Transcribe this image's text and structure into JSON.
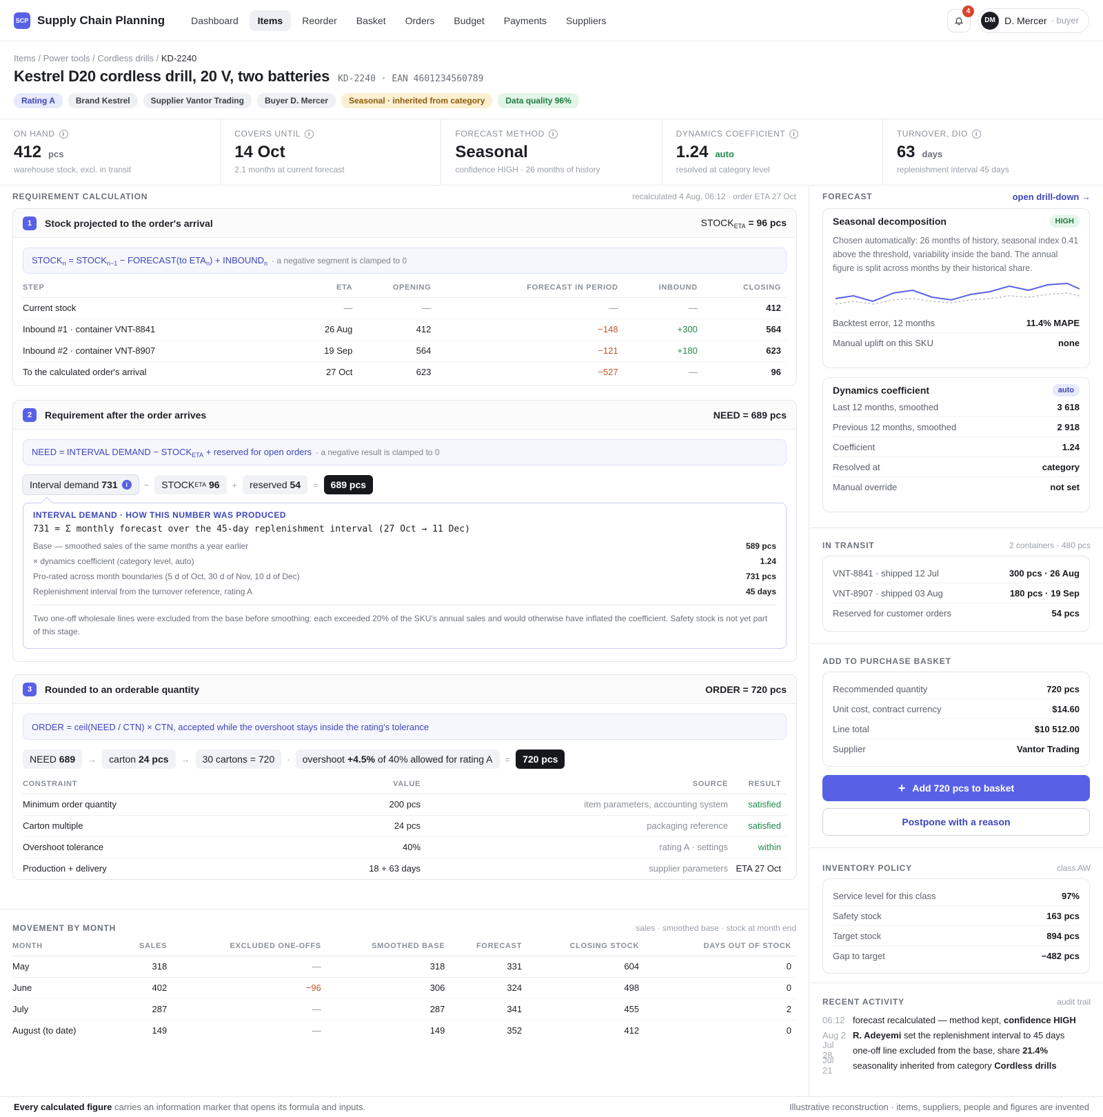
{
  "app": {
    "logo": "SCP",
    "name": "Supply Chain Planning"
  },
  "nav": [
    {
      "label": "Dashboard"
    },
    {
      "label": "Items",
      "active": true
    },
    {
      "label": "Reorder"
    },
    {
      "label": "Basket"
    },
    {
      "label": "Orders"
    },
    {
      "label": "Budget"
    },
    {
      "label": "Payments"
    },
    {
      "label": "Suppliers"
    }
  ],
  "notifications": {
    "count": "4"
  },
  "user": {
    "initials": "DM",
    "name": "D. Mercer",
    "role": "· buyer"
  },
  "breadcrumb": {
    "items": [
      "Items",
      "Power tools",
      "Cordless drills"
    ],
    "current": "KD-2240"
  },
  "item": {
    "title": "Kestrel D20 cordless drill, 20 V, two batteries",
    "code": "KD-2240 · EAN 4601234560789"
  },
  "tags": [
    {
      "label": "Rating A",
      "style": "blue"
    },
    {
      "label": "Brand Kestrel",
      "style": "grey"
    },
    {
      "label": "Supplier Vantor Trading",
      "style": "grey"
    },
    {
      "label": "Buyer D. Mercer",
      "style": "grey"
    },
    {
      "label": "Seasonal · inherited from category",
      "style": "amber"
    },
    {
      "label": "Data quality 96%",
      "style": "mint"
    }
  ],
  "kpis": [
    {
      "label": "ON HAND",
      "value": "412",
      "unit": "pcs",
      "sub": "warehouse stock, excl. in transit"
    },
    {
      "label": "COVERS UNTIL",
      "value": "14 Oct",
      "unit": "",
      "sub": "2.1 months at current forecast"
    },
    {
      "label": "FORECAST METHOD",
      "value": "Seasonal",
      "unit": "",
      "sub": "confidence HIGH · 26 months of history"
    },
    {
      "label": "DYNAMICS COEFFICIENT",
      "value": "1.24",
      "unit": "auto",
      "sub": "resolved at category level"
    },
    {
      "label": "TURNOVER, DIO",
      "value": "63",
      "unit": "days",
      "sub": "replenishment interval 45 days"
    }
  ],
  "requirement": {
    "heading": "REQUIREMENT CALCULATION",
    "meta": "recalculated 4 Aug, 06:12 · order ETA 27 Oct",
    "stage1": {
      "num": "1",
      "title": "Stock projected to the order's arrival",
      "result_label": "STOCK",
      "result_sub": "ETA",
      "result_value": "= 96 pcs",
      "formula_note": "· a negative segment is clamped to 0",
      "columns": [
        "STEP",
        "ETA",
        "OPENING",
        "FORECAST IN PERIOD",
        "INBOUND",
        "CLOSING"
      ],
      "rows": [
        [
          "Current stock",
          "—",
          "—",
          "—",
          "—",
          "412"
        ],
        [
          "Inbound #1 · container VNT-8841",
          "26 Aug",
          "412",
          "−148",
          "+300",
          "564"
        ],
        [
          "Inbound #2 · container VNT-8907",
          "19 Sep",
          "564",
          "−121",
          "+180",
          "623"
        ],
        [
          "To the calculated order's arrival",
          "27 Oct",
          "623",
          "−527",
          "—",
          "96"
        ]
      ]
    },
    "stage2": {
      "num": "2",
      "title": "Requirement after the order arrives",
      "result_value": "NEED = 689 pcs",
      "formula_note": "· a negative result is clamped to 0",
      "pills": {
        "demand_label": "Interval demand",
        "demand_value": "731",
        "stock_label": "STOCK",
        "stock_sub": "ETA",
        "stock_value": "96",
        "reserved_label": "reserved",
        "reserved_value": "54",
        "result": "689 pcs"
      },
      "explain": {
        "heading": "INTERVAL DEMAND · HOW THIS NUMBER WAS PRODUCED",
        "formula": "731 = Σ monthly forecast over the 45-day replenishment interval (27 Oct → 11 Dec)",
        "rows": [
          {
            "label": "Base — smoothed sales of the same months a year earlier",
            "value": "589 pcs"
          },
          {
            "label": "× dynamics coefficient (category level, auto)",
            "value": "1.24"
          },
          {
            "label": "Pro-rated across month boundaries (5 d of Oct, 30 d of Nov, 10 d of Dec)",
            "value": "731 pcs"
          },
          {
            "label": "Replenishment interval from the turnover reference, rating A",
            "value": "45 days"
          }
        ],
        "note": "Two one-off wholesale lines were excluded from the base before smoothing: each exceeded 20% of the SKU's annual sales and would otherwise have inflated the coefficient. Safety stock is not yet part of this stage."
      }
    },
    "stage3": {
      "num": "3",
      "title": "Rounded to an orderable quantity",
      "result_value": "ORDER = 720 pcs",
      "formula": "ORDER = ceil(NEED / CTN) × CTN, accepted while the overshoot stays inside the rating's tolerance",
      "pills": {
        "need_label": "NEED",
        "need_value": "689",
        "carton_label": "carton",
        "carton_value": "24 pcs",
        "cartons": "30 cartons = 720",
        "overshoot_pre": "overshoot",
        "overshoot_value": "+4.5%",
        "overshoot_post": "of 40% allowed for rating A",
        "result": "720 pcs"
      },
      "columns": [
        "CONSTRAINT",
        "VALUE",
        "SOURCE",
        "RESULT"
      ],
      "rows": [
        [
          "Minimum order quantity",
          "200 pcs",
          "item parameters, accounting system",
          "satisfied"
        ],
        [
          "Carton multiple",
          "24 pcs",
          "packaging reference",
          "satisfied"
        ],
        [
          "Overshoot tolerance",
          "40%",
          "rating A · settings",
          "within"
        ],
        [
          "Production + delivery",
          "18 + 63 days",
          "supplier parameters",
          "ETA 27 Oct"
        ]
      ]
    }
  },
  "movement": {
    "heading": "MOVEMENT BY MONTH",
    "meta": "sales · smoothed base · stock at month end",
    "columns": [
      "MONTH",
      "SALES",
      "EXCLUDED ONE-OFFS",
      "SMOOTHED BASE",
      "FORECAST",
      "CLOSING STOCK",
      "DAYS OUT OF STOCK"
    ],
    "rows": [
      [
        "May",
        "318",
        "—",
        "318",
        "331",
        "604",
        "0"
      ],
      [
        "June",
        "402",
        "−96",
        "306",
        "324",
        "498",
        "0"
      ],
      [
        "July",
        "287",
        "—",
        "287",
        "341",
        "455",
        "2"
      ],
      [
        "August (to date)",
        "149",
        "—",
        "149",
        "352",
        "412",
        "0"
      ]
    ]
  },
  "forecast": {
    "heading": "FORECAST",
    "link": "open drill-down →",
    "card_title": "Seasonal decomposition",
    "confidence": "HIGH",
    "description": "Chosen automatically: 26 months of history, seasonal index 0.41 above the threshold, variability inside the band. The annual figure is split across months by their historical share.",
    "rows": [
      {
        "label": "Backtest error, 12 months",
        "value": "11.4% MAPE"
      },
      {
        "label": "Manual uplift on this SKU",
        "value": "none"
      }
    ]
  },
  "dynamics": {
    "title": "Dynamics coefficient",
    "chip": "auto",
    "rows": [
      {
        "label": "Last 12 months, smoothed",
        "value": "3 618"
      },
      {
        "label": "Previous 12 months, smoothed",
        "value": "2 918"
      },
      {
        "label": "Coefficient",
        "value": "1.24"
      },
      {
        "label": "Resolved at",
        "value": "category"
      },
      {
        "label": "Manual override",
        "value": "not set"
      }
    ]
  },
  "transit": {
    "heading": "IN TRANSIT",
    "meta": "2 containers · 480 pcs",
    "rows": [
      {
        "label": "VNT-8841 · shipped 12 Jul",
        "value": "300 pcs · 26 Aug"
      },
      {
        "label": "VNT-8907 · shipped 03 Aug",
        "value": "180 pcs · 19 Sep"
      },
      {
        "label": "Reserved for customer orders",
        "value": "54 pcs"
      }
    ]
  },
  "basket": {
    "heading": "ADD TO PURCHASE BASKET",
    "rows": [
      {
        "label": "Recommended quantity",
        "value": "720 pcs"
      },
      {
        "label": "Unit cost, contract currency",
        "value": "$14.60"
      },
      {
        "label": "Line total",
        "value": "$10 512.00"
      },
      {
        "label": "Supplier",
        "value": "Vantor Trading"
      }
    ],
    "add_button": "Add 720 pcs to basket",
    "postpone_button": "Postpone with a reason"
  },
  "policy": {
    "heading": "INVENTORY POLICY",
    "meta": "class AW",
    "rows": [
      {
        "label": "Service level for this class",
        "value": "97%"
      },
      {
        "label": "Safety stock",
        "value": "163 pcs"
      },
      {
        "label": "Target stock",
        "value": "894 pcs"
      },
      {
        "label": "Gap to target",
        "value": "−482 pcs"
      }
    ]
  },
  "activity": {
    "heading": "RECENT ACTIVITY",
    "meta": "audit trail",
    "items": [
      {
        "time": "06:12",
        "pre": "forecast recalculated — method kept,",
        "strong": "confidence HIGH",
        "post": ""
      },
      {
        "time": "Aug 2",
        "pre": "",
        "strong": "R. Adeyemi",
        "post": "set the replenishment interval to 45 days"
      },
      {
        "time": "Jul 28",
        "pre": "one-off line excluded from the base, share",
        "strong": "21.4%",
        "post": ""
      },
      {
        "time": "Jul 21",
        "pre": "seasonality inherited from category",
        "strong": "Cordless drills",
        "post": ""
      }
    ]
  },
  "footer": {
    "strong": "Every calculated figure",
    "text": "carries an information marker that opens its formula and inputs.",
    "right": "Illustrative reconstruction · items, suppliers, people and figures are invented"
  }
}
